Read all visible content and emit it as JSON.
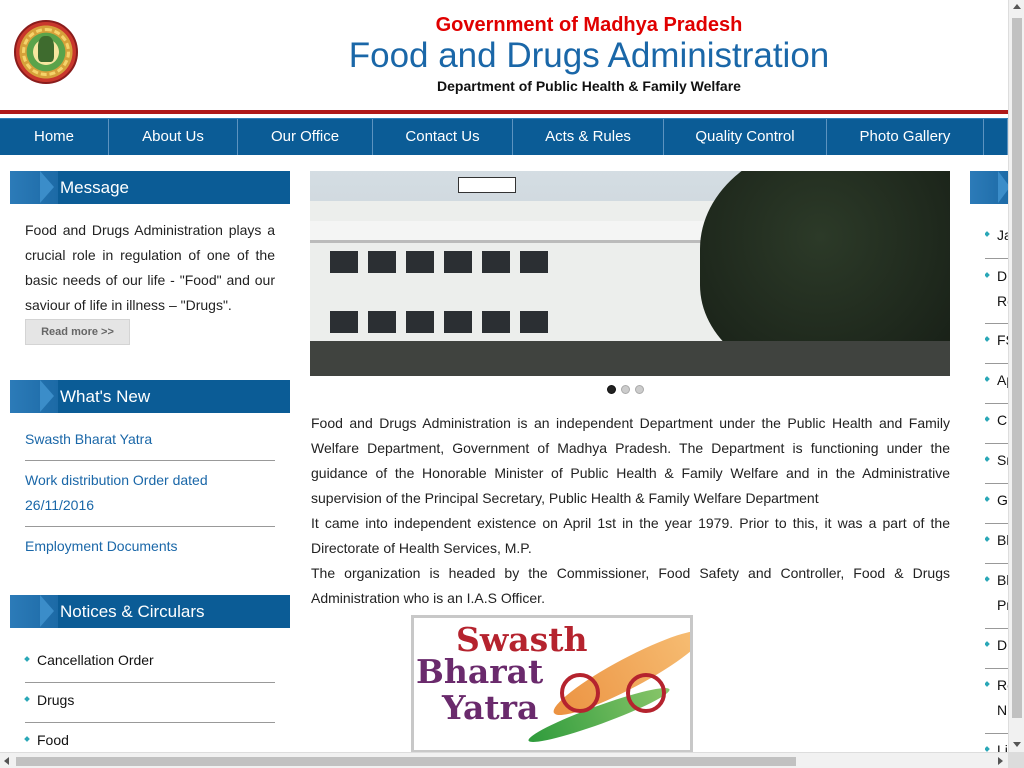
{
  "header": {
    "top_title": "Government of Madhya Pradesh",
    "main_title": "Food and Drugs Administration",
    "subtitle": "Department of Public Health & Family Welfare",
    "logo_icon": "mp-state-emblem-icon"
  },
  "nav": {
    "items": [
      "Home",
      "About Us",
      "Our Office",
      "Contact Us",
      "Acts & Rules",
      "Quality Control",
      "Photo Gallery",
      ""
    ]
  },
  "message": {
    "heading": "Message",
    "text": "Food and Drugs Administration plays a crucial role in regulation of one of the basic needs of our life - \"Food\" and our saviour of life in illness – \"Drugs\".",
    "read_more": "Read more >>"
  },
  "whats_new": {
    "heading": "What's New",
    "items": [
      "Swasth Bharat Yatra",
      "Work distribution Order dated 26/11/2016",
      "Employment Documents"
    ]
  },
  "notices": {
    "heading": "Notices & Circulars",
    "items": [
      "Cancellation Order",
      "Drugs",
      "Food"
    ]
  },
  "slider": {
    "slide_count": 3,
    "active_index": 0
  },
  "main": {
    "paragraphs": [
      "Food and Drugs Administration is an independent Department under the Public Health and Family Welfare Department, Government of Madhya Pradesh. The Department is functioning under the guidance of the Honorable Minister of Public Health & Family Welfare and in the Administrative supervision of the Principal Secretary, Public Health & Family Welfare Department",
      "It came into independent existence on April 1st in the year 1979. Prior to this, it was a part of the Directorate of Health Services, M.P.",
      "The organization is headed by the Commissioner, Food Safety and Controller, Food & Drugs Administration who is an I.A.S Officer."
    ],
    "banner": {
      "word1": "Swasth",
      "word2": "Bharat",
      "word3": "Yatra"
    }
  },
  "right_column": {
    "items": [
      "Ja",
      "Dr",
      "Re",
      "FS",
      "Ap",
      "Cl",
      "Sr",
      "G",
      "Bl",
      "Bl",
      "Pr",
      "Dr",
      "Re",
      "NI",
      "Li"
    ]
  },
  "colors": {
    "accent_blue": "#0b5c96",
    "header_red": "#e00000",
    "title_blue": "#1a67a8",
    "border_red": "#b01919"
  }
}
